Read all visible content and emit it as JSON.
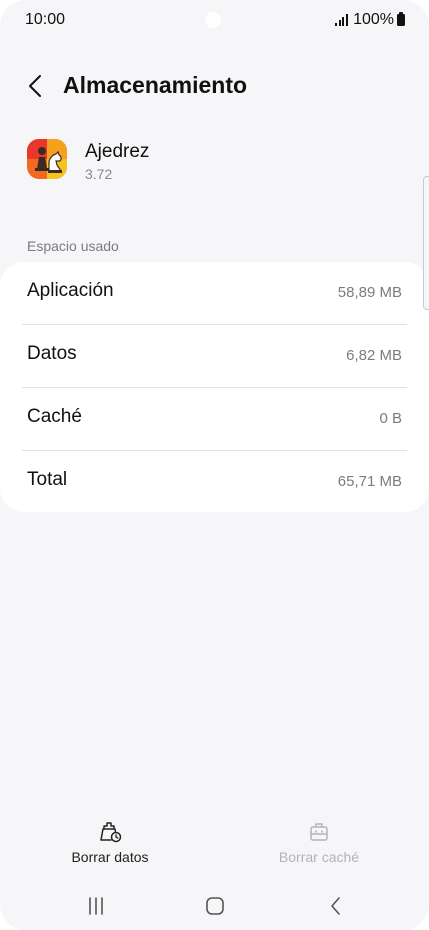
{
  "status_bar": {
    "time": "10:00",
    "battery": "100%"
  },
  "header": {
    "title": "Almacenamiento",
    "back_icon": "chevron-left-icon"
  },
  "app": {
    "name": "Ajedrez",
    "version": "3.72",
    "icon": "chess-app-icon",
    "icon_colors": [
      "#f26a21",
      "#e8372c",
      "#f6c31e",
      "#3a2a22"
    ]
  },
  "storage": {
    "section_label": "Espacio usado",
    "rows": [
      {
        "label": "Aplicación",
        "value": "58,89 MB"
      },
      {
        "label": "Datos",
        "value": "6,82 MB"
      },
      {
        "label": "Caché",
        "value": "0 B"
      },
      {
        "label": "Total",
        "value": "65,71 MB"
      }
    ]
  },
  "actions": {
    "clear_data": {
      "label": "Borrar datos",
      "icon": "clear-data-icon",
      "enabled": true
    },
    "clear_cache": {
      "label": "Borrar caché",
      "icon": "clear-cache-icon",
      "enabled": false
    }
  },
  "nav_bar": {
    "recent_icon": "recent-apps-icon",
    "home_icon": "home-icon",
    "back_icon": "back-icon"
  },
  "colors": {
    "background": "#f6f6f8",
    "card": "#ffffff",
    "secondary_text": "#7b7b80",
    "disabled_text": "#b3b3b7"
  }
}
